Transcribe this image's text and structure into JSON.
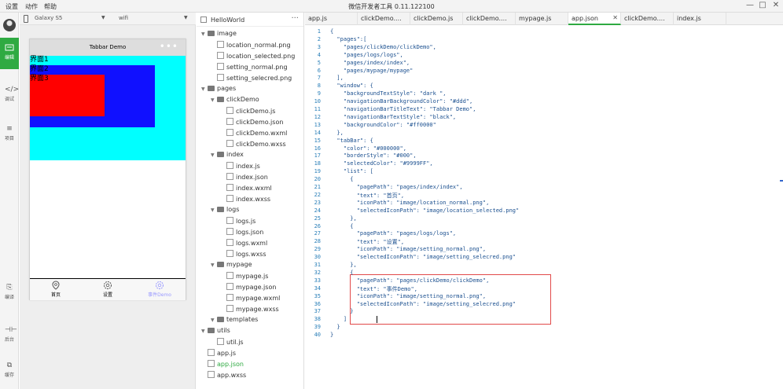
{
  "menu": {
    "settings": "设置",
    "actions": "动作",
    "help": "帮助"
  },
  "window": {
    "title": "微信开发者工具 0.11.122100",
    "minimize": "—",
    "maximize": "□",
    "close": "✕"
  },
  "activity": {
    "items": [
      {
        "label": "编辑",
        "icon": "edit-icon"
      },
      {
        "label": "调试",
        "icon": "code-icon"
      },
      {
        "label": "项目",
        "icon": "list-icon"
      },
      {
        "label": "编译",
        "icon": "compile-icon"
      },
      {
        "label": "后台",
        "icon": "backend-icon"
      },
      {
        "label": "缓存",
        "icon": "cache-icon"
      }
    ]
  },
  "simulator": {
    "device": "Galaxy S5",
    "network": "wifi",
    "nav_title": "Tabbar Demo",
    "nav_dots": "•••",
    "page_lines": [
      "界面1",
      "界面2",
      "界面3"
    ],
    "tabs": [
      {
        "label": "首页",
        "icon": "location-icon"
      },
      {
        "label": "设置",
        "icon": "settings-icon"
      },
      {
        "label": "事件Demo",
        "icon": "settings-icon"
      }
    ],
    "colors": {
      "nav_bg": "#dddddd",
      "page_bg": "#00ffff",
      "blue": "#1010ff",
      "red": "#ff0000",
      "tab_selected": "#9999ff"
    }
  },
  "tree": {
    "project": "HelloWorld",
    "more": "···",
    "nodes": [
      {
        "label": "image",
        "type": "folder",
        "level": 0
      },
      {
        "label": "location_normal.png",
        "type": "file",
        "level": 1
      },
      {
        "label": "location_selected.png",
        "type": "file",
        "level": 1
      },
      {
        "label": "setting_normal.png",
        "type": "file",
        "level": 1
      },
      {
        "label": "setting_selecred.png",
        "type": "file",
        "level": 1
      },
      {
        "label": "pages",
        "type": "folder",
        "level": 0
      },
      {
        "label": "clickDemo",
        "type": "folder",
        "level": 1
      },
      {
        "label": "clickDemo.js",
        "type": "file",
        "level": 2
      },
      {
        "label": "clickDemo.json",
        "type": "file",
        "level": 2
      },
      {
        "label": "clickDemo.wxml",
        "type": "file",
        "level": 2
      },
      {
        "label": "clickDemo.wxss",
        "type": "file",
        "level": 2
      },
      {
        "label": "index",
        "type": "folder",
        "level": 1
      },
      {
        "label": "index.js",
        "type": "file",
        "level": 2
      },
      {
        "label": "index.json",
        "type": "file",
        "level": 2
      },
      {
        "label": "index.wxml",
        "type": "file",
        "level": 2
      },
      {
        "label": "index.wxss",
        "type": "file",
        "level": 2
      },
      {
        "label": "logs",
        "type": "folder",
        "level": 1
      },
      {
        "label": "logs.js",
        "type": "file",
        "level": 2
      },
      {
        "label": "logs.json",
        "type": "file",
        "level": 2
      },
      {
        "label": "logs.wxml",
        "type": "file",
        "level": 2
      },
      {
        "label": "logs.wxss",
        "type": "file",
        "level": 2
      },
      {
        "label": "mypage",
        "type": "folder",
        "level": 1
      },
      {
        "label": "mypage.js",
        "type": "file",
        "level": 2
      },
      {
        "label": "mypage.json",
        "type": "file",
        "level": 2
      },
      {
        "label": "mypage.wxml",
        "type": "file",
        "level": 2
      },
      {
        "label": "mypage.wxss",
        "type": "file",
        "level": 2
      },
      {
        "label": "templates",
        "type": "folder",
        "level": 1
      },
      {
        "label": "utils",
        "type": "folder",
        "level": 0
      },
      {
        "label": "util.js",
        "type": "file",
        "level": 1
      },
      {
        "label": "app.js",
        "type": "file",
        "level": 0
      },
      {
        "label": "app.json",
        "type": "file",
        "level": 0,
        "highlight": true
      },
      {
        "label": "app.wxss",
        "type": "file",
        "level": 0
      }
    ]
  },
  "editor": {
    "tabs": [
      {
        "label": "app.js",
        "closable": false
      },
      {
        "label": "clickDemo....",
        "closable": false
      },
      {
        "label": "clickDemo.js",
        "closable": false
      },
      {
        "label": "clickDemo....",
        "closable": false
      },
      {
        "label": "mypage.js",
        "closable": false
      },
      {
        "label": "app.json",
        "closable": true,
        "active": true
      },
      {
        "label": "clickDemo....",
        "closable": false
      },
      {
        "label": "index.js",
        "closable": false
      }
    ],
    "close_glyph": "✕",
    "lines": [
      "{",
      "  \"pages\":[",
      "    \"pages/clickDemo/clickDemo\",",
      "    \"pages/logs/logs\",",
      "    \"pages/index/index\",",
      "    \"pages/mypage/mypage\"",
      "  ],",
      "  \"window\": {",
      "    \"backgroundTextStyle\": \"dark \",",
      "    \"navigationBarBackgroundColor\": \"#ddd\",",
      "    \"navigationBarTitleText\": \"Tabbar Demo\",",
      "    \"navigationBarTextStyle\": \"black\",",
      "    \"backgroundColor\": \"#ff0000\"",
      "  },",
      "  \"tabBar\": {",
      "    \"color\": \"#000000\",",
      "    \"borderStyle\": \"#000\",",
      "    \"selectedColor\": \"#9999FF\",",
      "    \"list\": [",
      "      {",
      "        \"pagePath\": \"pages/index/index\",",
      "        \"text\": \"首页\",",
      "        \"iconPath\": \"image/location_normal.png\",",
      "        \"selectedIconPath\": \"image/location_selected.png\"",
      "      },",
      "      {",
      "        \"pagePath\": \"pages/logs/logs\",",
      "        \"text\": \"设置\",",
      "        \"iconPath\": \"image/setting_normal.png\",",
      "        \"selectedIconPath\": \"image/setting_selecred.png\"",
      "      },",
      "      {",
      "        \"pagePath\": \"pages/clickDemo/clickDemo\",",
      "        \"text\": \"事件Demo\",",
      "        \"iconPath\": \"image/setting_normal.png\",",
      "        \"selectedIconPath\": \"image/setting_selecred.png\"",
      "      }",
      "    ]",
      "  }",
      "}"
    ],
    "highlight_color": "#e24a4a"
  }
}
